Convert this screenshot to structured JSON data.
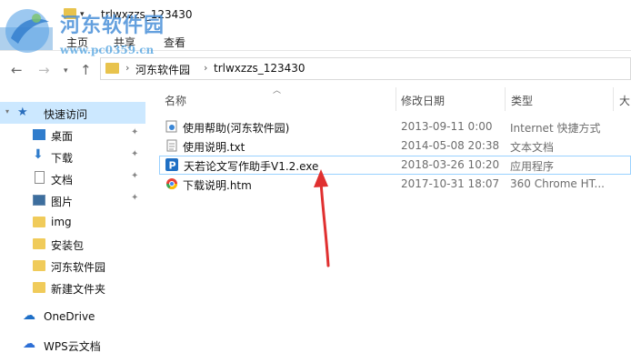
{
  "window": {
    "title": "trlwxzzs_123430"
  },
  "watermark": {
    "title": "河东软件园",
    "url": "www.pc0359.cn"
  },
  "ribbon": {
    "tabs": [
      "主页",
      "共享",
      "查看"
    ]
  },
  "address": {
    "crumbs": [
      "河东软件园",
      "trlwxzzs_123430"
    ]
  },
  "sidebar": {
    "items": [
      {
        "label": "快速访问"
      },
      {
        "label": "桌面"
      },
      {
        "label": "下载"
      },
      {
        "label": "文档"
      },
      {
        "label": "图片"
      },
      {
        "label": "img"
      },
      {
        "label": "安装包"
      },
      {
        "label": "河东软件园"
      },
      {
        "label": "新建文件夹"
      },
      {
        "label": "OneDrive"
      },
      {
        "label": "WPS云文档"
      }
    ]
  },
  "columns": {
    "name": "名称",
    "date": "修改日期",
    "type": "类型",
    "size": "大"
  },
  "files": [
    {
      "name": "使用帮助(河东软件园)",
      "date": "2013-09-11 0:00",
      "type": "Internet 快捷方式",
      "icon": "url-shortcut-icon"
    },
    {
      "name": "使用说明.txt",
      "date": "2014-05-08 20:38",
      "type": "文本文档",
      "icon": "text-file-icon"
    },
    {
      "name": "天若论文写作助手V1.2.exe",
      "date": "2018-03-26 10:20",
      "type": "应用程序",
      "icon": "app-p-icon"
    },
    {
      "name": "下载说明.htm",
      "date": "2017-10-31 18:07",
      "type": "360 Chrome HT...",
      "icon": "chrome-html-icon"
    }
  ],
  "colors": {
    "selection": "#cce8ff",
    "accent": "#1979ca",
    "annotation_arrow": "#e03030"
  }
}
